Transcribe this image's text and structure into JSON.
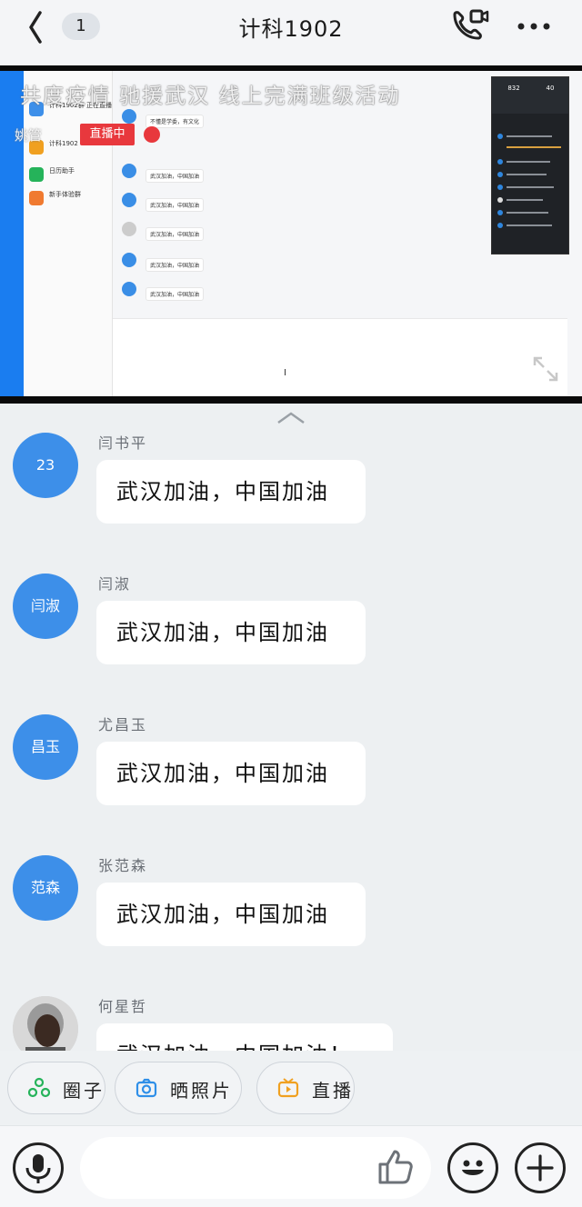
{
  "header": {
    "back_icon": "chevron-left-icon",
    "unread_count": "1",
    "title": "计科1902",
    "call_icon": "video-call-icon",
    "more_icon": "more-dots-icon"
  },
  "live": {
    "overlay_title": "共度疫情 驰援武汉 线上完满班级活动",
    "overlay_sub": "姚管",
    "badge": "直播中",
    "stats": [
      "832",
      "40"
    ],
    "screen": {
      "group": "计科1902群 正在直播",
      "chat_lines": [
        {
          "name": "",
          "text": "不懂是学委，有文化"
        },
        {
          "name": "",
          "text": "武汉加油，中国加油"
        },
        {
          "name": "",
          "text": "武汉加油，中国加油"
        },
        {
          "name": "",
          "text": "武汉加油，中国加油"
        },
        {
          "name": "",
          "text": "武汉加油，中国加油"
        },
        {
          "name": "",
          "text": "武汉加油，中国加油"
        }
      ],
      "list": [
        {
          "title": "计科1902",
          "sub": ""
        },
        {
          "title": "日历助手",
          "sub": ""
        },
        {
          "title": "新手体验群",
          "sub": ""
        }
      ],
      "cursor": "I"
    }
  },
  "messages": [
    {
      "avatar_text": "23",
      "sender": "闫书平",
      "text": "武汉加油，中国加油"
    },
    {
      "avatar_text": "闫淑",
      "sender": "闫淑",
      "text": "武汉加油，中国加油"
    },
    {
      "avatar_text": "昌玉",
      "sender": "尤昌玉",
      "text": "武汉加油，中国加油"
    },
    {
      "avatar_text": "范森",
      "sender": "张范森",
      "text": "武汉加油，中国加油"
    },
    {
      "avatar_text": "",
      "sender": "何星哲",
      "text": "武汉加油，中国加油！"
    }
  ],
  "quick_actions": [
    {
      "label": "圈子",
      "icon": "circle-friends-icon",
      "color": "#25b35a"
    },
    {
      "label": "晒照片",
      "icon": "camera-icon",
      "color": "#2f8fe8"
    },
    {
      "label": "直播",
      "icon": "live-tv-icon",
      "color": "#f0a020"
    }
  ],
  "input": {
    "voice_icon": "microphone-icon",
    "like_icon": "thumbs-up-icon",
    "emoji_icon": "emoji-icon",
    "add_icon": "plus-icon"
  },
  "colors": {
    "accent": "#3d8fe9",
    "live_red": "#e8383d",
    "background": "#edf0f2"
  }
}
